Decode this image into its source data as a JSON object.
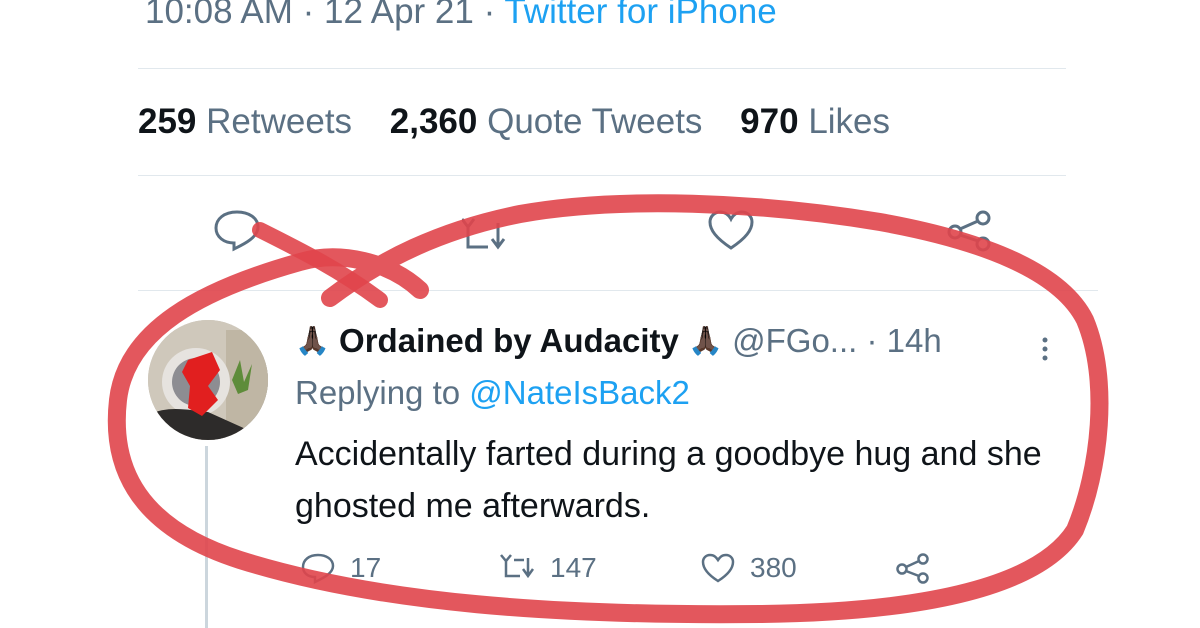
{
  "tweet": {
    "time": "10:08 AM",
    "sep": "·",
    "date": "12 Apr 21",
    "source": "Twitter for iPhone",
    "stats": {
      "retweets_count": "259",
      "retweets_label": "Retweets",
      "quotes_count": "2,360",
      "quotes_label": "Quote Tweets",
      "likes_count": "970",
      "likes_label": "Likes"
    },
    "actions": [
      "reply-icon",
      "retweet-icon",
      "like-icon",
      "share-icon"
    ]
  },
  "reply": {
    "emoji": "🙏🏿",
    "name": "Ordained by Audacity",
    "handle": "@FGo...",
    "dot": "·",
    "time": "14h",
    "replying_prefix": "Replying to",
    "replying_to": "@NateIsBack2",
    "text": "Accidentally farted during a goodbye hug and she ghosted me afterwards.",
    "reply_count": "17",
    "retweet_count": "147",
    "like_count": "380"
  },
  "colors": {
    "accent": "#1da1f2",
    "muted": "#5b7083",
    "marker": "#e0454b"
  }
}
